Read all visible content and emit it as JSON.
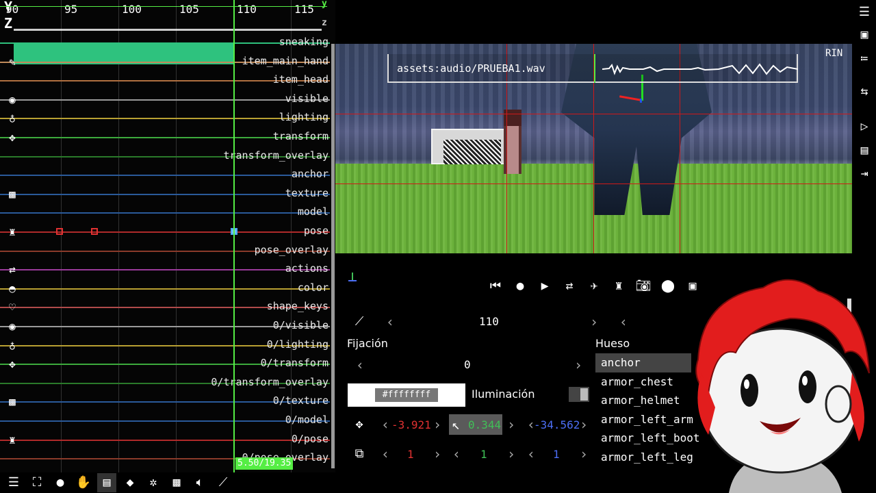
{
  "ruler": {
    "ticks": [
      "90",
      "95",
      "100",
      "105",
      "110",
      "115"
    ],
    "axis_letters": [
      "Y",
      "Z",
      "y",
      "z"
    ]
  },
  "tracks": [
    {
      "label": "sneaking",
      "color": "#2ec27e",
      "icon": ""
    },
    {
      "label": "item_main_hand",
      "color": "#c08a5a",
      "icon": "pencil-icon"
    },
    {
      "label": "item_head",
      "color": "#b07040",
      "icon": ""
    },
    {
      "label": "visible",
      "color": "#9a9a9a",
      "icon": "eye-icon"
    },
    {
      "label": "lighting",
      "color": "#b8a032",
      "icon": "lightbulb-icon"
    },
    {
      "label": "transform",
      "color": "#3caa3c",
      "icon": "move-arrows-icon"
    },
    {
      "label": "transform_overlay",
      "color": "#2a7a2a",
      "icon": ""
    },
    {
      "label": "anchor",
      "color": "#2a5a9a",
      "icon": ""
    },
    {
      "label": "texture",
      "color": "#2a5a9a",
      "icon": "checker-icon"
    },
    {
      "label": "model",
      "color": "#2a5a9a",
      "icon": ""
    },
    {
      "label": "pose",
      "color": "#b02a2a",
      "icon": "figure-icon"
    },
    {
      "label": "pose_overlay",
      "color": "#8a3a2a",
      "icon": ""
    },
    {
      "label": "actions",
      "color": "#9a3a9a",
      "icon": "swap-arrows-icon"
    },
    {
      "label": "color",
      "color": "#b8a032",
      "icon": "bucket-icon"
    },
    {
      "label": "shape_keys",
      "color": "#b04a4a",
      "icon": "heart-icon"
    },
    {
      "label": "0/visible",
      "color": "#9a9a9a",
      "icon": "eye-icon"
    },
    {
      "label": "0/lighting",
      "color": "#b8a032",
      "icon": "lightbulb-icon"
    },
    {
      "label": "0/transform",
      "color": "#3caa3c",
      "icon": "move-arrows-icon"
    },
    {
      "label": "0/transform_overlay",
      "color": "#2a7a2a",
      "icon": ""
    },
    {
      "label": "0/texture",
      "color": "#2a5a9a",
      "icon": "checker-icon"
    },
    {
      "label": "0/model",
      "color": "#2a5a9a",
      "icon": ""
    },
    {
      "label": "0/pose",
      "color": "#b02a2a",
      "icon": "figure-icon"
    },
    {
      "label": "0/pose_overlay",
      "color": "#8a3a2a",
      "icon": ""
    }
  ],
  "timeline": {
    "time_readout": "5.50/19.35",
    "playhead_color": "#55ee44"
  },
  "viewport": {
    "audio_file": "assets:audio/PRUEBA1.wav",
    "run_label": "RIN"
  },
  "properties": {
    "tick": "110",
    "fixation_label": "Fijación",
    "fixation_value": "0",
    "color_hex": "#ffffffff",
    "lighting_label": "Iluminación",
    "position": {
      "x": "-3.921",
      "y": "0.344",
      "z": "-34.562"
    },
    "scale": {
      "x": "1",
      "y": "1",
      "z": "1"
    }
  },
  "bones": {
    "heading": "Hueso",
    "items": [
      "anchor",
      "armor_chest",
      "armor_helmet",
      "armor_left_arm",
      "armor_left_boot",
      "armor_left_leg"
    ],
    "selected": "anchor"
  },
  "colors": {
    "accent_green": "#55ee44",
    "axis_x": "#e03131",
    "axis_y": "#40c057",
    "axis_z": "#4c6ef5"
  }
}
